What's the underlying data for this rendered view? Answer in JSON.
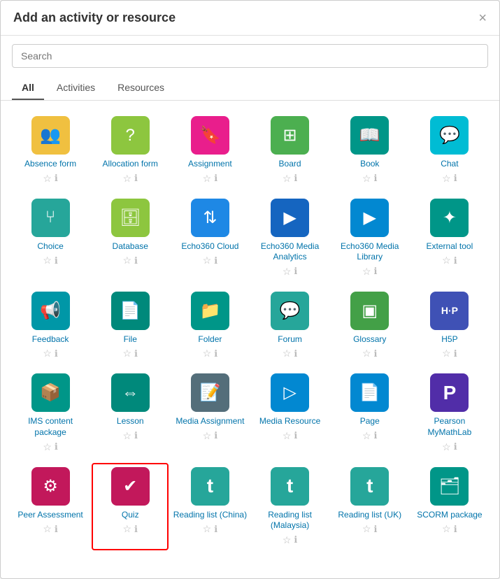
{
  "modal": {
    "title": "Add an activity or resource",
    "close_label": "×"
  },
  "search": {
    "placeholder": "Search"
  },
  "tabs": [
    {
      "id": "all",
      "label": "All",
      "active": true
    },
    {
      "id": "activities",
      "label": "Activities",
      "active": false
    },
    {
      "id": "resources",
      "label": "Resources",
      "active": false
    }
  ],
  "items": [
    {
      "id": "absence-form",
      "label": "Absence form",
      "icon": "👥",
      "bg": "bg-yellow",
      "highlighted": false
    },
    {
      "id": "allocation-form",
      "label": "Allocation form",
      "icon": "?",
      "bg": "bg-lime",
      "highlighted": false
    },
    {
      "id": "assignment",
      "label": "Assignment",
      "icon": "📋",
      "bg": "bg-pink",
      "highlighted": false
    },
    {
      "id": "board",
      "label": "Board",
      "icon": "⊞",
      "bg": "bg-green",
      "highlighted": false
    },
    {
      "id": "book",
      "label": "Book",
      "icon": "📖",
      "bg": "bg-teal",
      "highlighted": false
    },
    {
      "id": "chat",
      "label": "Chat",
      "icon": "💬",
      "bg": "bg-cyan",
      "highlighted": false
    },
    {
      "id": "choice",
      "label": "Choice",
      "icon": "⑂",
      "bg": "bg-teal2",
      "highlighted": false
    },
    {
      "id": "database",
      "label": "Database",
      "icon": "🗄",
      "bg": "bg-lime",
      "highlighted": false
    },
    {
      "id": "echo360-cloud",
      "label": "Echo360 Cloud",
      "icon": "⇅",
      "bg": "bg-darkblue",
      "highlighted": false
    },
    {
      "id": "echo360-media-analytics",
      "label": "Echo360 Media Analytics",
      "icon": "▶",
      "bg": "bg-blue",
      "highlighted": false
    },
    {
      "id": "echo360-media-library",
      "label": "Echo360 Media Library",
      "icon": "▶",
      "bg": "bg-lightblue",
      "highlighted": false
    },
    {
      "id": "external-tool",
      "label": "External tool",
      "icon": "✦",
      "bg": "bg-teal",
      "highlighted": false
    },
    {
      "id": "feedback",
      "label": "Feedback",
      "icon": "📢",
      "bg": "bg-darkcyan",
      "highlighted": false
    },
    {
      "id": "file",
      "label": "File",
      "icon": "📄",
      "bg": "bg-teal3",
      "highlighted": false
    },
    {
      "id": "folder",
      "label": "Folder",
      "icon": "📁",
      "bg": "bg-teal",
      "highlighted": false
    },
    {
      "id": "forum",
      "label": "Forum",
      "icon": "💬",
      "bg": "bg-teal2",
      "highlighted": false
    },
    {
      "id": "glossary",
      "label": "Glossary",
      "icon": "▣",
      "bg": "bg-greenbright",
      "highlighted": false
    },
    {
      "id": "h5p",
      "label": "H5P",
      "icon": "H·P",
      "bg": "bg-indigo",
      "highlighted": false
    },
    {
      "id": "ims-content-package",
      "label": "IMS content package",
      "icon": "📦",
      "bg": "bg-teal",
      "highlighted": false
    },
    {
      "id": "lesson",
      "label": "Lesson",
      "icon": "⇔",
      "bg": "bg-teal3",
      "highlighted": false
    },
    {
      "id": "media-assignment",
      "label": "Media Assignment",
      "icon": "📝",
      "bg": "bg-bluegray",
      "highlighted": false
    },
    {
      "id": "media-resource",
      "label": "Media Resource",
      "icon": "▶",
      "bg": "bg-lightblue",
      "highlighted": false
    },
    {
      "id": "page",
      "label": "Page",
      "icon": "📄",
      "bg": "bg-lightblue",
      "highlighted": false
    },
    {
      "id": "pearson-mymathlab",
      "label": "Pearson MyMathLab",
      "icon": "P",
      "bg": "bg-deeppurple",
      "highlighted": false
    },
    {
      "id": "peer-assessment",
      "label": "Peer Assessment",
      "icon": "⚙",
      "bg": "bg-magenta",
      "highlighted": false
    },
    {
      "id": "quiz",
      "label": "Quiz",
      "icon": "✔",
      "bg": "bg-magenta",
      "highlighted": true
    },
    {
      "id": "reading-list-china",
      "label": "Reading list (China)",
      "icon": "t",
      "bg": "bg-teal2",
      "highlighted": false
    },
    {
      "id": "reading-list-malaysia",
      "label": "Reading list (Malaysia)",
      "icon": "t",
      "bg": "bg-teal2",
      "highlighted": false
    },
    {
      "id": "reading-list-uk",
      "label": "Reading list (UK)",
      "icon": "t",
      "bg": "bg-teal2",
      "highlighted": false
    },
    {
      "id": "scorm-package",
      "label": "SCORM package",
      "icon": "🗂",
      "bg": "bg-teal",
      "highlighted": false
    }
  ]
}
